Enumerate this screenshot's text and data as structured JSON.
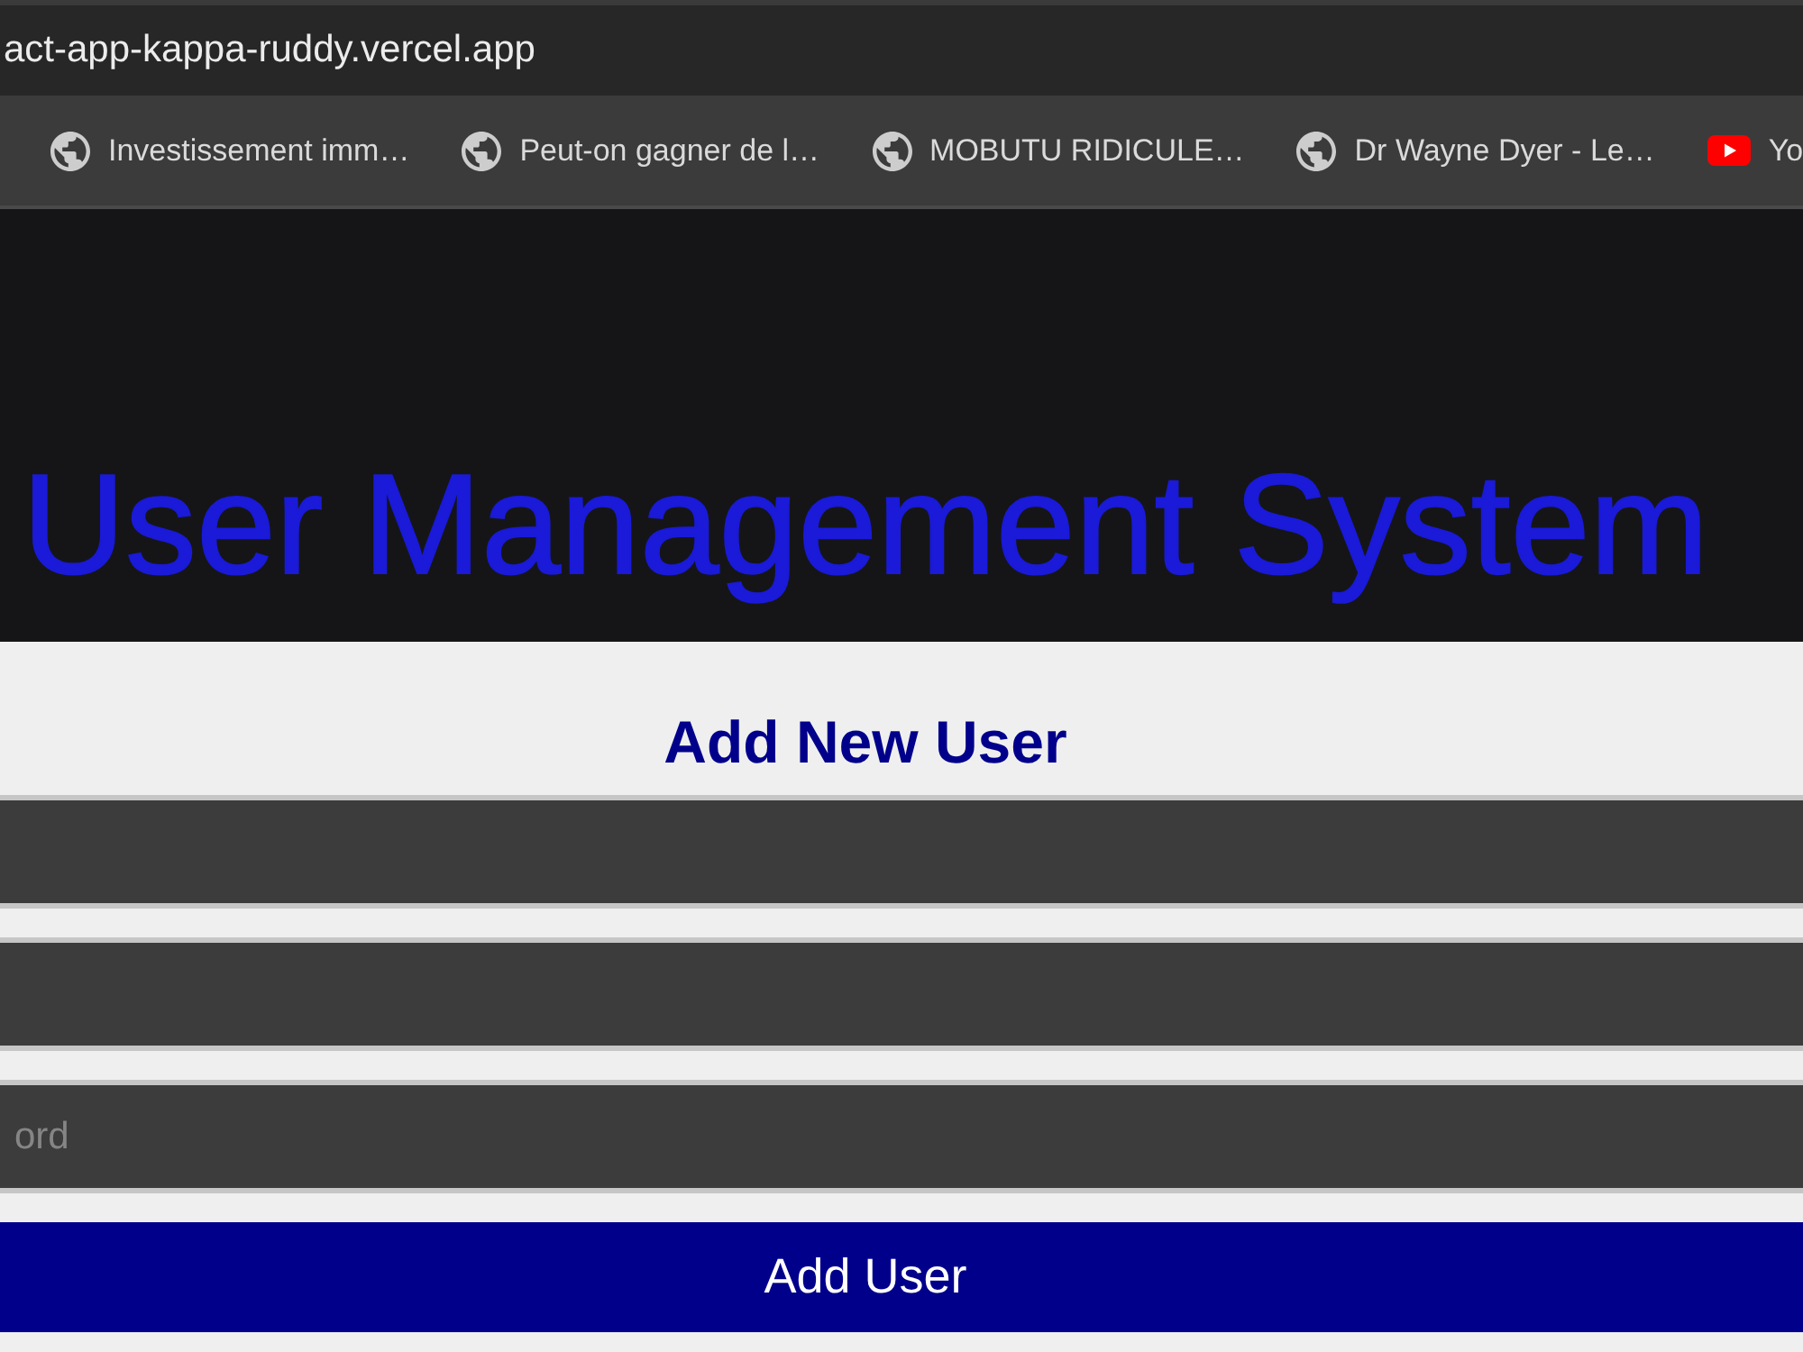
{
  "browser": {
    "address_bar": {
      "url": "act-app-kappa-ruddy.vercel.app"
    },
    "bookmarks": [
      {
        "kind": "web",
        "label": "Investissement imm…"
      },
      {
        "kind": "web",
        "label": "Peut-on gagner de l…"
      },
      {
        "kind": "web",
        "label": "MOBUTU RIDICULE…"
      },
      {
        "kind": "web",
        "label": "Dr Wayne Dyer - Le…"
      },
      {
        "kind": "video",
        "label": "Yo"
      }
    ]
  },
  "header": {
    "title": "User Management System"
  },
  "form": {
    "heading": "Add New User",
    "fields": [
      {
        "kind": "input"
      },
      {
        "kind": "input"
      },
      {
        "kind": "input",
        "placeholder": "ord"
      }
    ],
    "submit_button": "Add User"
  }
}
